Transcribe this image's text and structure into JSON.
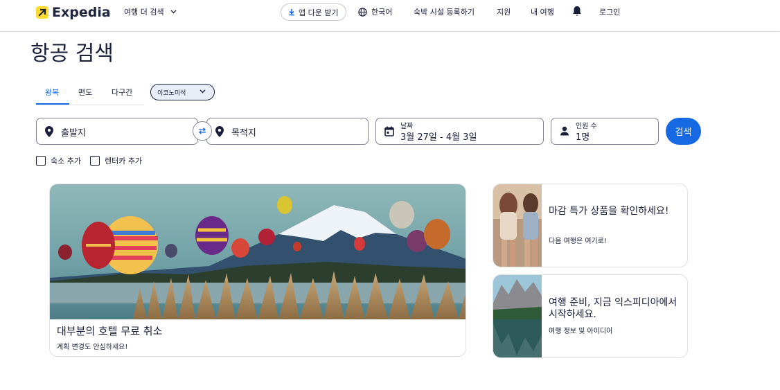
{
  "header": {
    "logo_text": "Expedia",
    "more_travel": "여행 더 검색",
    "app_download": "앱 다운 받기",
    "language": "한국어",
    "list_property": "숙박 시설 등록하기",
    "support": "지원",
    "my_trips": "내 여행",
    "login": "로그인"
  },
  "page_title": "항공 검색",
  "tabs": [
    {
      "label": "왕복",
      "active": true
    },
    {
      "label": "편도",
      "active": false
    },
    {
      "label": "다구간",
      "active": false
    }
  ],
  "cabin_class": "이코노미석",
  "search": {
    "origin_placeholder": "출발지",
    "destination_placeholder": "목적지",
    "date_label": "날짜",
    "date_value": "3월 27일 - 4월 3일",
    "travelers_label": "인원 수",
    "travelers_value": "1명",
    "search_button": "검색"
  },
  "options": {
    "add_stay": "숙소 추가",
    "add_car": "렌터카 추가"
  },
  "cards": {
    "hotel_cancel": {
      "title": "대부분의 호텔 무료 취소",
      "subtitle": "계획 변경도 안심하세요!"
    },
    "last_minute": {
      "title": "마감 특가 상품을 확인하세요!",
      "subtitle": "다음 여행은 여기로!"
    },
    "travel_prep": {
      "title": "여행 준비, 지금 익스피디아에서 시작하세요.",
      "subtitle": "여행 정보 및 아이디어"
    }
  },
  "colors": {
    "brand_blue": "#1668e3",
    "logo_yellow": "#fddb32",
    "text_dark": "#191e3b"
  }
}
